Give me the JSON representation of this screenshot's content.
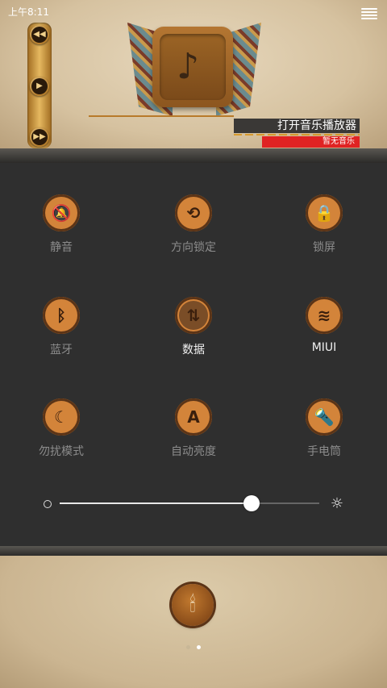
{
  "status_bar": {
    "time": "上午8:11",
    "menu_icon": "hamburger-menu-icon"
  },
  "music_widget": {
    "title": "打开音乐播放器",
    "subtitle": "暂无音乐",
    "controls": [
      {
        "name": "previous-icon",
        "glyph": "◀◀"
      },
      {
        "name": "play-icon",
        "glyph": "▶"
      },
      {
        "name": "next-icon",
        "glyph": "▶▶"
      }
    ],
    "album_icon": "♪"
  },
  "toggles": [
    {
      "label": "静音",
      "icon": "mute-bell-icon",
      "glyph": "🔕",
      "active": false
    },
    {
      "label": "方向锁定",
      "icon": "rotation-lock-icon",
      "glyph": "⟲",
      "active": false
    },
    {
      "label": "锁屏",
      "icon": "lock-icon",
      "glyph": "🔒",
      "active": false
    },
    {
      "label": "蓝牙",
      "icon": "bluetooth-icon",
      "glyph": "ᛒ",
      "active": false
    },
    {
      "label": "数据",
      "icon": "data-transfer-icon",
      "glyph": "⇅",
      "active": true
    },
    {
      "label": "MIUI",
      "icon": "wifi-icon",
      "glyph": "≋",
      "active": true
    },
    {
      "label": "勿扰模式",
      "icon": "moon-icon",
      "glyph": "☾",
      "active": false
    },
    {
      "label": "自动亮度",
      "icon": "auto-brightness-icon",
      "glyph": "A",
      "active": false
    },
    {
      "label": "手电筒",
      "icon": "flashlight-icon",
      "glyph": "🔦",
      "active": false
    }
  ],
  "brightness": {
    "value_fraction": 0.74,
    "min_icon": "dim-circle-icon",
    "max_icon": "sun-icon"
  },
  "bottom": {
    "home_icon": "candle-icon",
    "pages": 2,
    "current_page": 2
  },
  "colors": {
    "accent": "#d3843a",
    "panel": "#2f2f2f",
    "alert": "#e02323"
  }
}
